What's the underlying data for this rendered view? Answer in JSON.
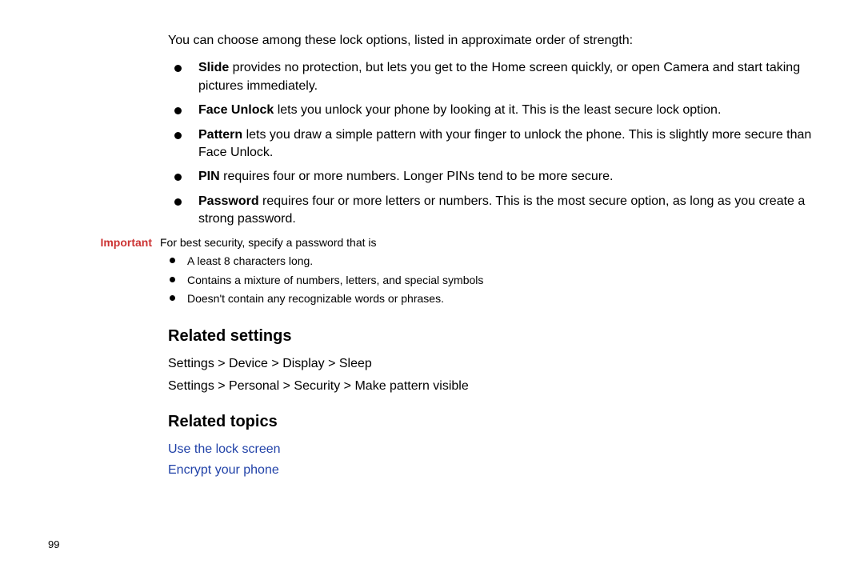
{
  "intro": "You can choose among these lock options, listed in approximate order of strength:",
  "options": [
    {
      "label": "Slide",
      "text": " provides no protection, but lets you get to the Home screen quickly, or open Camera and start taking pictures immediately."
    },
    {
      "label": "Face Unlock",
      "text": " lets you unlock your phone by looking at it. This is the least secure lock option."
    },
    {
      "label": "Pattern",
      "text": " lets you draw a simple pattern with your finger to unlock the phone. This is slightly more secure than Face Unlock."
    },
    {
      "label": "PIN",
      "text": " requires four or more numbers. Longer PINs tend to be more secure."
    },
    {
      "label": "Password",
      "text": " requires four or more letters or numbers. This is the most secure option, as long as you create a strong password."
    }
  ],
  "note": {
    "label": "Important",
    "intro": "For best security, specify a password that is",
    "items": [
      "A least 8 characters long.",
      "Contains a mixture of numbers, letters, and special symbols",
      "Doesn't contain any recognizable words or phrases."
    ]
  },
  "related_settings": {
    "heading": "Related settings",
    "paths": [
      "Settings > Device > Display > Sleep",
      "Settings > Personal > Security > Make pattern visible"
    ]
  },
  "related_topics": {
    "heading": "Related topics",
    "links": [
      "Use the lock screen",
      "Encrypt your phone"
    ]
  },
  "page_number": "99"
}
